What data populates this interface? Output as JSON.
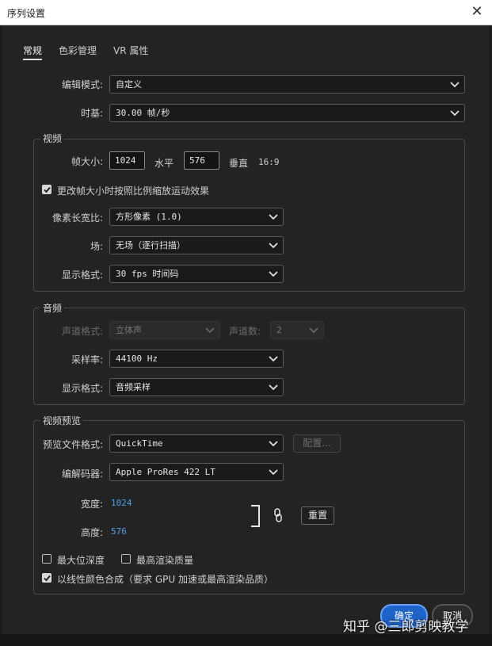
{
  "window": {
    "title": "序列设置",
    "close_glyph": "✕"
  },
  "tabs": [
    {
      "label": "常规",
      "active": true
    },
    {
      "label": "色彩管理",
      "active": false
    },
    {
      "label": "VR 属性",
      "active": false
    }
  ],
  "general": {
    "edit_mode_label": "编辑模式:",
    "edit_mode_value": "自定义",
    "timebase_label": "时基:",
    "timebase_value": "30.00  帧/秒"
  },
  "video": {
    "group_title": "视频",
    "frame_size_label": "帧大小:",
    "width_value": "1024",
    "horizontal_label": "水平",
    "height_value": "576",
    "vertical_label": "垂直",
    "aspect_ratio": "16:9",
    "scale_checkbox_label": "更改帧大小时按照比例缩放运动效果",
    "scale_checkbox_checked": true,
    "pixel_aspect_label": "像素长宽比:",
    "pixel_aspect_value": "方形像素 (1.0)",
    "fields_label": "场:",
    "fields_value": "无场（逐行扫描）",
    "display_format_label": "显示格式:",
    "display_format_value": "30 fps 时间码"
  },
  "audio": {
    "group_title": "音频",
    "channel_format_label": "声道格式:",
    "channel_format_value": "立体声",
    "channel_count_label": "声道数:",
    "channel_count_value": "2",
    "sample_rate_label": "采样率:",
    "sample_rate_value": "44100 Hz",
    "display_format_label": "显示格式:",
    "display_format_value": "音频采样"
  },
  "preview": {
    "group_title": "视频预览",
    "file_format_label": "预览文件格式:",
    "file_format_value": "QuickTime",
    "configure_button": "配置...",
    "codec_label": "编解码器:",
    "codec_value": "Apple ProRes 422 LT",
    "width_label": "宽度:",
    "width_value": "1024",
    "height_label": "高度:",
    "height_value": "576",
    "reset_button": "重置",
    "max_bit_depth_label": "最大位深度",
    "max_bit_depth_checked": false,
    "max_render_quality_label": "最高渲染质量",
    "max_render_quality_checked": false,
    "linear_color_label": "以线性颜色合成（要求 GPU 加速或最高渲染品质）",
    "linear_color_checked": true
  },
  "footer": {
    "ok_button": "确定",
    "cancel_button": "取消",
    "watermark": "知乎 @三郎剪映教学"
  },
  "colors": {
    "accent": "#1e63c7",
    "value_blue": "#4f9fe8",
    "background": "#232323"
  }
}
